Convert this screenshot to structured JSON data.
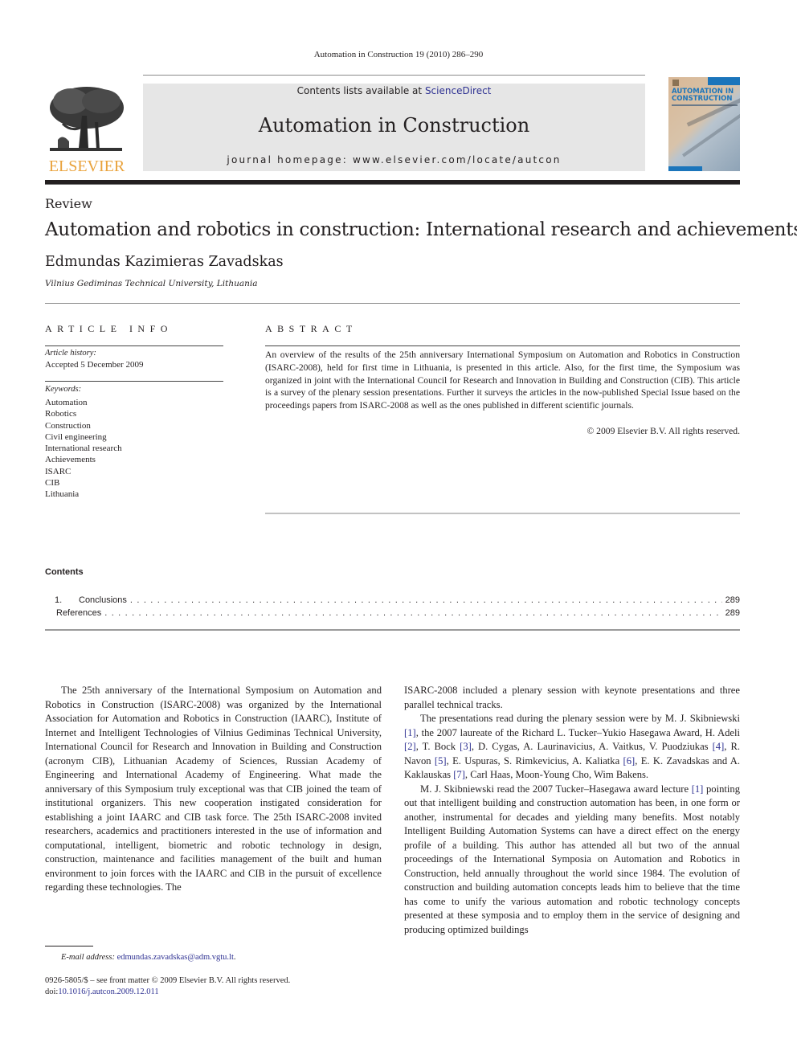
{
  "header": {
    "running_head": "Automation in Construction 19 (2010) 286–290",
    "publisher_wordmark": "ELSEVIER",
    "contents_prefix": "Contents lists available at ",
    "contents_link": "ScienceDirect",
    "journal_title": "Automation in Construction",
    "homepage_prefix": "journal homepage: ",
    "homepage_url": "www.elsevier.com/locate/autcon",
    "cover": {
      "title_line1": "AUTOMATION IN",
      "title_line2": "CONSTRUCTION"
    }
  },
  "article": {
    "type": "Review",
    "title": "Automation and robotics in construction: International research and achievements",
    "author": "Edmundas Kazimieras Zavadskas",
    "affiliation": "Vilnius Gediminas Technical University, Lithuania"
  },
  "article_info": {
    "heading": "ARTICLE INFO",
    "history_label": "Article history:",
    "history_value": "Accepted 5 December 2009",
    "keywords_label": "Keywords:",
    "keywords": [
      "Automation",
      "Robotics",
      "Construction",
      "Civil engineering",
      "International research",
      "Achievements",
      "ISARC",
      "CIB",
      "Lithuania"
    ]
  },
  "abstract": {
    "heading": "ABSTRACT",
    "text": "An overview of the results of the 25th anniversary International Symposium on Automation and Robotics in Construction (ISARC-2008), held for first time in Lithuania, is presented in this article. Also, for the first time, the Symposium was organized in joint with the International Council for Research and Innovation in Building and Construction (CIB). This article is a survey of the plenary session presentations. Further it surveys the articles in the now-published Special Issue based on the proceedings papers from ISARC-2008 as well as the ones published in different scientific journals.",
    "copyright": "© 2009 Elsevier B.V. All rights reserved."
  },
  "contents": {
    "heading": "Contents",
    "entries": [
      {
        "number": "1.",
        "label": "Conclusions",
        "page": "289"
      },
      {
        "number": "",
        "label": "References",
        "page": "289"
      }
    ]
  },
  "body": {
    "left_paragraph": "The 25th anniversary of the International Symposium on Automation and Robotics in Construction (ISARC-2008) was organized by the International Association for Automation and Robotics in Construction (IAARC), Institute of Internet and Intelligent Technologies of Vilnius Gediminas Technical University, International Council for Research and Innovation in Building and Construction (acronym CIB), Lithuanian Academy of Sciences, Russian Academy of Engineering and International Academy of Engineering. What made the anniversary of this Symposium truly exceptional was that CIB joined the team of institutional organizers. This new cooperation instigated consideration for establishing a joint IAARC and CIB task force. The 25th ISARC-2008 invited researchers, academics and practitioners interested in the use of information and computational, intelligent, biometric and robotic technology in design, construction, maintenance and facilities management of the built and human environment to join forces with the IAARC and CIB in the pursuit of excellence regarding these technologies. The",
    "right_p1": "ISARC-2008 included a plenary session with keynote presentations and three parallel technical tracks.",
    "right_p2": {
      "s1": "The presentations read during the plenary session were by M. J. Skibniewski ",
      "r1": "[1]",
      "s2": ", the 2007 laureate of the Richard L. Tucker–Yukio Hasegawa Award, H. Adeli ",
      "r2": "[2]",
      "s3": ", T. Bock ",
      "r3": "[3]",
      "s4": ", D. Cygas, A. Laurinavicius, A. Vaitkus, V. Puodziukas ",
      "r4": "[4]",
      "s5": ", R. Navon ",
      "r5": "[5]",
      "s6": ", E. Uspuras, S. Rimkevicius, A. Kaliatka ",
      "r6": "[6]",
      "s7": ", E. K. Zavadskas and A. Kaklauskas ",
      "r7": "[7]",
      "s8": ", Carl Haas, Moon-Young Cho, Wim Bakens."
    },
    "right_p3": {
      "s1": "M. J. Skibniewski read the 2007 Tucker–Hasegawa award lecture ",
      "r1": "[1]",
      "s2": " pointing out that intelligent building and construction automation has been, in one form or another, instrumental for decades and yielding many benefits. Most notably Intelligent Building Automation Systems can have a direct effect on the energy profile of a building. This author has attended all but two of the annual proceedings of the International Symposia on Automation and Robotics in Construction, held annually throughout the world since 1984. The evolution of construction and building automation concepts leads him to believe that the time has come to unify the various automation and robotic technology concepts presented at these symposia and to employ them in the service of designing and producing optimized buildings"
    }
  },
  "footer": {
    "email_label": "E-mail address: ",
    "email": "edmundas.zavadskas@adm.vgtu.lt",
    "email_suffix": ".",
    "front_matter": "0926-5805/$ – see front matter © 2009 Elsevier B.V. All rights reserved.",
    "doi_prefix": "doi:",
    "doi": "10.1016/j.autcon.2009.12.011"
  },
  "colors": {
    "link": "#2e3192",
    "elsevier_orange": "#e9a23b",
    "banner_bg": "#e6e6e6",
    "cover_blue": "#1b75bb"
  }
}
